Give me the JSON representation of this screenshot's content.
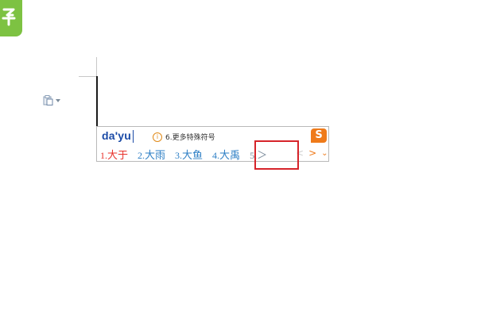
{
  "app": {
    "logo_icon": "wps-logo-icon",
    "logo_color": "#7dc242"
  },
  "document": {
    "paste_options_icon": "paste-options-icon",
    "paste_options_dropdown_icon": "chevron-down-icon"
  },
  "ime": {
    "composition": "da'yu",
    "hint_icon": "info-icon",
    "hint_text": "6.更多特殊符号",
    "logo_char": "S",
    "logo_color": "#ef7a1a",
    "candidates": [
      {
        "num": "1.",
        "text": "大于"
      },
      {
        "num": "2.",
        "text": "大雨"
      },
      {
        "num": "3.",
        "text": "大鱼"
      },
      {
        "num": "4.",
        "text": "大禹"
      },
      {
        "num": "5.",
        "text": "＞"
      }
    ],
    "nav": {
      "prev": "<",
      "next": ">",
      "more": "⌄"
    }
  },
  "annotation": {
    "color": "#d6242a"
  }
}
